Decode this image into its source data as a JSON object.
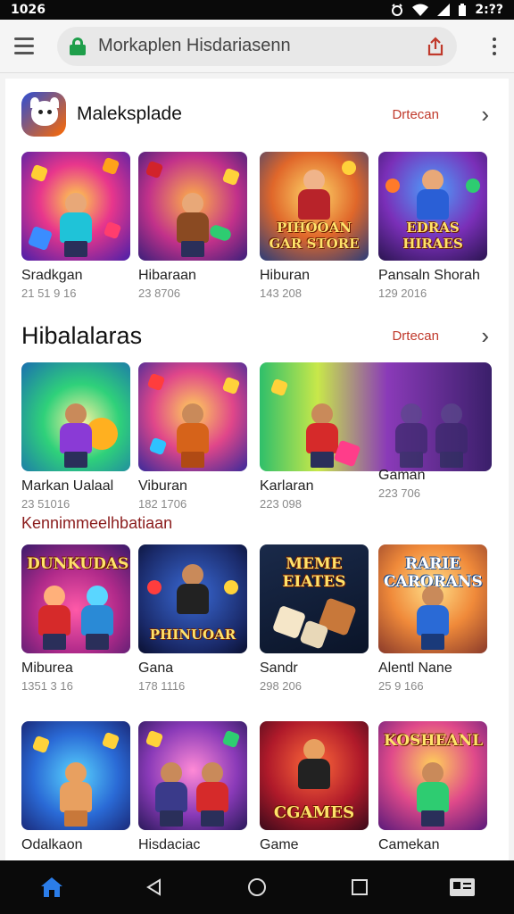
{
  "status_bar": {
    "time": "1026",
    "right_text": "2:??"
  },
  "browser": {
    "url": "Morkaplen Hisdariasenn"
  },
  "sections": [
    {
      "title": "Maleksplade",
      "more": "Drtecan",
      "cards": [
        {
          "name": "Sradkgan",
          "meta": "21 51 9 16"
        },
        {
          "name": "Hibaraan",
          "meta": "23 8706"
        },
        {
          "name": "Hiburan",
          "meta": "143 208",
          "art_title": "PIHOOAN GAR STORE"
        },
        {
          "name": "Pansaln Shorah",
          "meta": "129 2016",
          "art_title": "EDRAS HIRAES"
        }
      ]
    },
    {
      "title": "Hibalalaras",
      "more": "Drtecan",
      "cards": [
        {
          "name": "Markan Ualaal",
          "meta": "23 51016"
        },
        {
          "name": "Viburan",
          "meta": "182 1706"
        },
        {
          "name": "Karlaran",
          "meta": "223 098"
        },
        {
          "name": "Gaman",
          "meta": "223 706"
        }
      ]
    }
  ],
  "sub_heading": "Kennimmeelhbatiaan",
  "grid_rows": [
    [
      {
        "name": "Miburea",
        "meta": "1351 3 16",
        "art_title": "DUNKUDAS"
      },
      {
        "name": "Gana",
        "meta": "178 1116",
        "art_title": "PHINUOAR"
      },
      {
        "name": "Sandr",
        "meta": "298 206",
        "art_title": "MEME EIATES"
      },
      {
        "name": "Alentl Nane",
        "meta": "25 9 166",
        "art_title": "RARIE CARORANS"
      }
    ],
    [
      {
        "name": "Odalkaon",
        "meta": ""
      },
      {
        "name": "Hisdaciac",
        "meta": ""
      },
      {
        "name": "Game",
        "meta": "",
        "art_title": "CGAMES"
      },
      {
        "name": "Camekan",
        "meta": "",
        "art_title": "KOSHEANL"
      }
    ]
  ],
  "nav": {
    "home": "home-icon",
    "back": "back-icon",
    "home_circle": "circle-icon",
    "recents": "square-icon",
    "app": "card-icon"
  },
  "colors": {
    "accent": "#c0392b",
    "link": "#c0392b",
    "nav_active": "#2b7de9"
  }
}
